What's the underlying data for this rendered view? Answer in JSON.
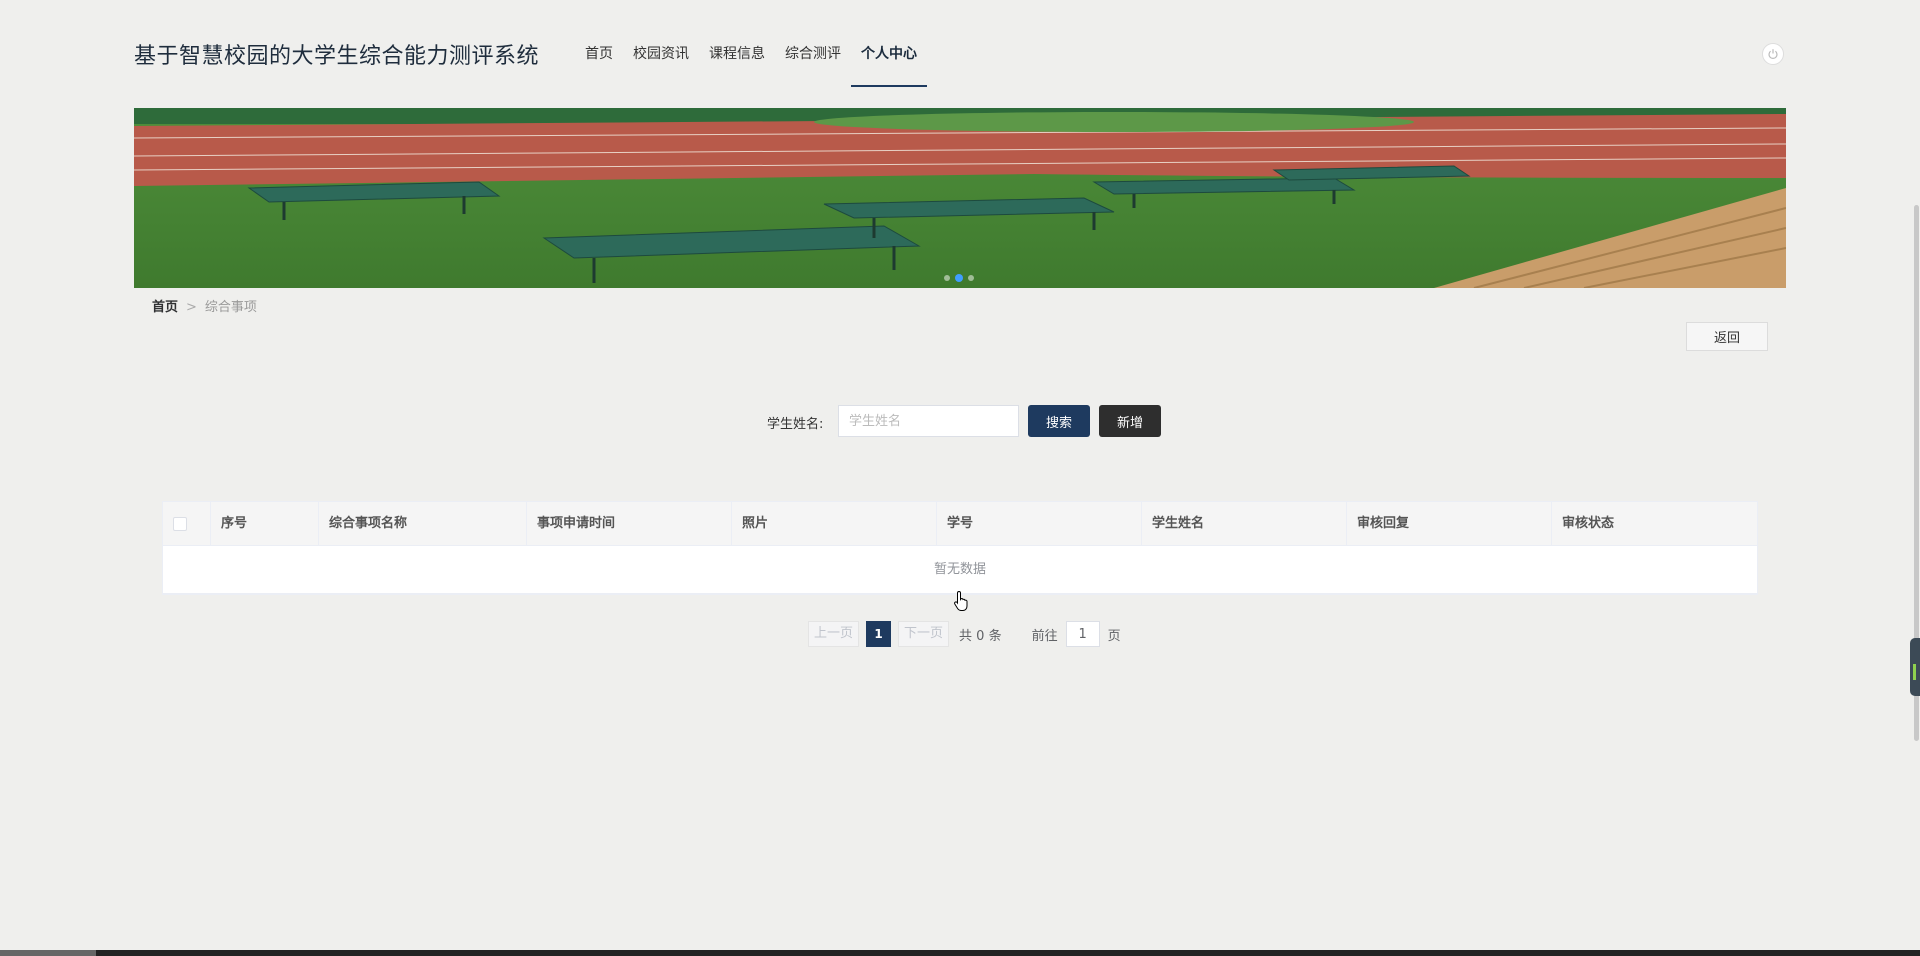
{
  "header": {
    "site_title": "基于智慧校园的大学生综合能力测评系统",
    "nav": [
      "首页",
      "校园资讯",
      "课程信息",
      "综合测评",
      "个人中心"
    ],
    "active_nav": "个人中心"
  },
  "breadcrumb": {
    "home": "首页",
    "separator": ">",
    "current": "综合事项"
  },
  "actions": {
    "back_label": "返回"
  },
  "search": {
    "label": "学生姓名:",
    "placeholder": "学生姓名",
    "search_button": "搜索",
    "add_button": "新增"
  },
  "table": {
    "columns": [
      "序号",
      "综合事项名称",
      "事项申请时间",
      "照片",
      "学号",
      "学生姓名",
      "审核回复",
      "审核状态"
    ],
    "rows": [],
    "empty_text": "暂无数据"
  },
  "pagination": {
    "prev": "上一页",
    "current_page": "1",
    "next": "下一页",
    "total": "共 0 条",
    "goto": "前往",
    "page_input": "1",
    "page_suffix": "页"
  },
  "colors": {
    "primary": "#1e3a5f",
    "add_button": "#2e2e2e",
    "background": "#efefed"
  },
  "icons": {
    "logout": "power-icon",
    "cursor": "hand-pointer-icon"
  }
}
